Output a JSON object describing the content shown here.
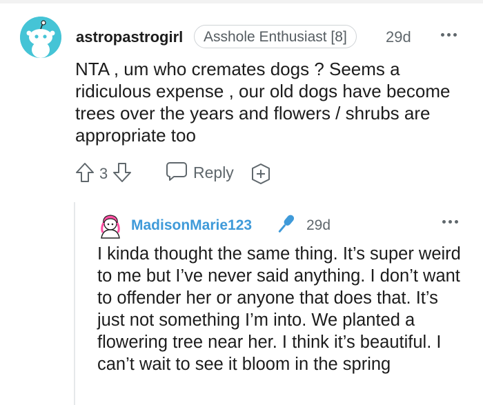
{
  "comment": {
    "username": "astropastrogirl",
    "flair": "Asshole Enthusiast [8]",
    "time": "29d",
    "body": "NTA , um who cremates dogs ? Seems a ridiculous expense , our old dogs have become trees over the years and flowers / shrubs are appropriate too",
    "vote_count": "3",
    "reply_label": "Reply",
    "avatar_color": "#45c4d6"
  },
  "reply": {
    "username": "MadisonMarie123",
    "username_color": "#3f9ad9",
    "time": "29d",
    "body": "I kinda thought the same thing. It’s super weird to me but I’ve never said anything. I don’t want to offender her or anyone that does that. It’s just not something I’m into. We planted a flowering tree near her. I think it’s beautiful. I can’t wait to see it bloom in the spring"
  }
}
